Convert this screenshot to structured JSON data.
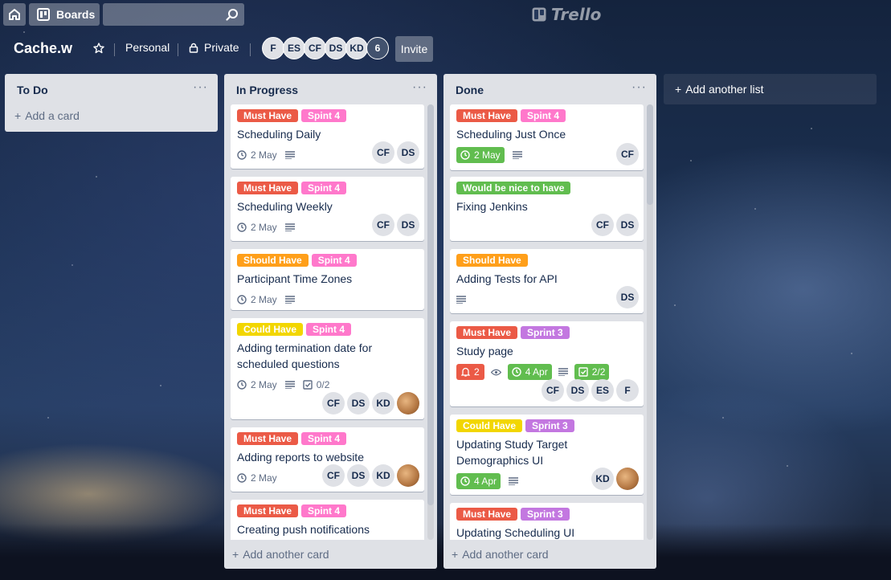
{
  "nav": {
    "boards_label": "Boards",
    "search": {
      "value": "",
      "placeholder": ""
    },
    "logo_text": "Trello"
  },
  "board": {
    "title": "Cache.w",
    "team": "Personal",
    "visibility": "Private",
    "members": [
      "F",
      "ES",
      "CF",
      "DS",
      "KD"
    ],
    "member_count": "6",
    "invite_label": "Invite"
  },
  "lists": [
    {
      "title": "To Do",
      "menu": "···",
      "add_card_label": "Add a card",
      "cards": []
    },
    {
      "title": "In Progress",
      "menu": "···",
      "add_card_label": "Add another card",
      "cards": [
        {
          "labels": [
            "Must Have",
            "Spint 4"
          ],
          "title": "Scheduling Daily",
          "due": "2 May",
          "members": [
            "CF",
            "DS"
          ]
        },
        {
          "labels": [
            "Must Have",
            "Spint 4"
          ],
          "title": "Scheduling Weekly",
          "due": "2 May",
          "members": [
            "CF",
            "DS"
          ]
        },
        {
          "labels": [
            "Should Have",
            "Spint 4"
          ],
          "title": "Participant Time Zones",
          "due": "2 May",
          "members": []
        },
        {
          "labels": [
            "Could Have",
            "Spint 4"
          ],
          "title": "Adding termination date for scheduled questions",
          "due": "2 May",
          "checklist": "0/2",
          "members": [
            "CF",
            "DS",
            "KD"
          ]
        },
        {
          "labels": [
            "Must Have",
            "Spint 4"
          ],
          "title": "Adding reports to website",
          "due": "2 May",
          "members": [
            "CF",
            "DS",
            "KD"
          ]
        },
        {
          "labels": [
            "Must Have",
            "Spint 4"
          ],
          "title": "Creating push notifications",
          "members": []
        }
      ]
    },
    {
      "title": "Done",
      "menu": "···",
      "add_card_label": "Add another card",
      "cards": [
        {
          "labels": [
            "Must Have",
            "Spint 4"
          ],
          "title": "Scheduling Just Once",
          "due": "2 May",
          "members": [
            "CF"
          ]
        },
        {
          "labels": [
            "Would be nice to have"
          ],
          "title": "Fixing Jenkins",
          "members": [
            "CF",
            "DS"
          ]
        },
        {
          "labels": [
            "Should Have"
          ],
          "title": "Adding Tests for API",
          "members": [
            "DS"
          ]
        },
        {
          "labels": [
            "Must Have",
            "Sprint 3"
          ],
          "title": "Study page",
          "notifications": "2",
          "due": "4 Apr",
          "checklist": "2/2",
          "members": [
            "CF",
            "DS",
            "ES",
            "F"
          ]
        },
        {
          "labels": [
            "Could Have",
            "Sprint 3"
          ],
          "title": "Updating Study Target Demographics UI",
          "due": "4 Apr",
          "members": [
            "KD"
          ]
        },
        {
          "labels": [
            "Must Have",
            "Sprint 3"
          ],
          "title": "Updating Scheduling UI",
          "members": []
        }
      ]
    }
  ],
  "add_list_label": "Add another list",
  "colors": {
    "must_have": "#eb5a46",
    "sprint": "#ff78cb",
    "should_have": "#ff9f1a",
    "could_have": "#f2d600",
    "nice_to_have": "#61bd4f",
    "sprint3": "#c377e0"
  }
}
